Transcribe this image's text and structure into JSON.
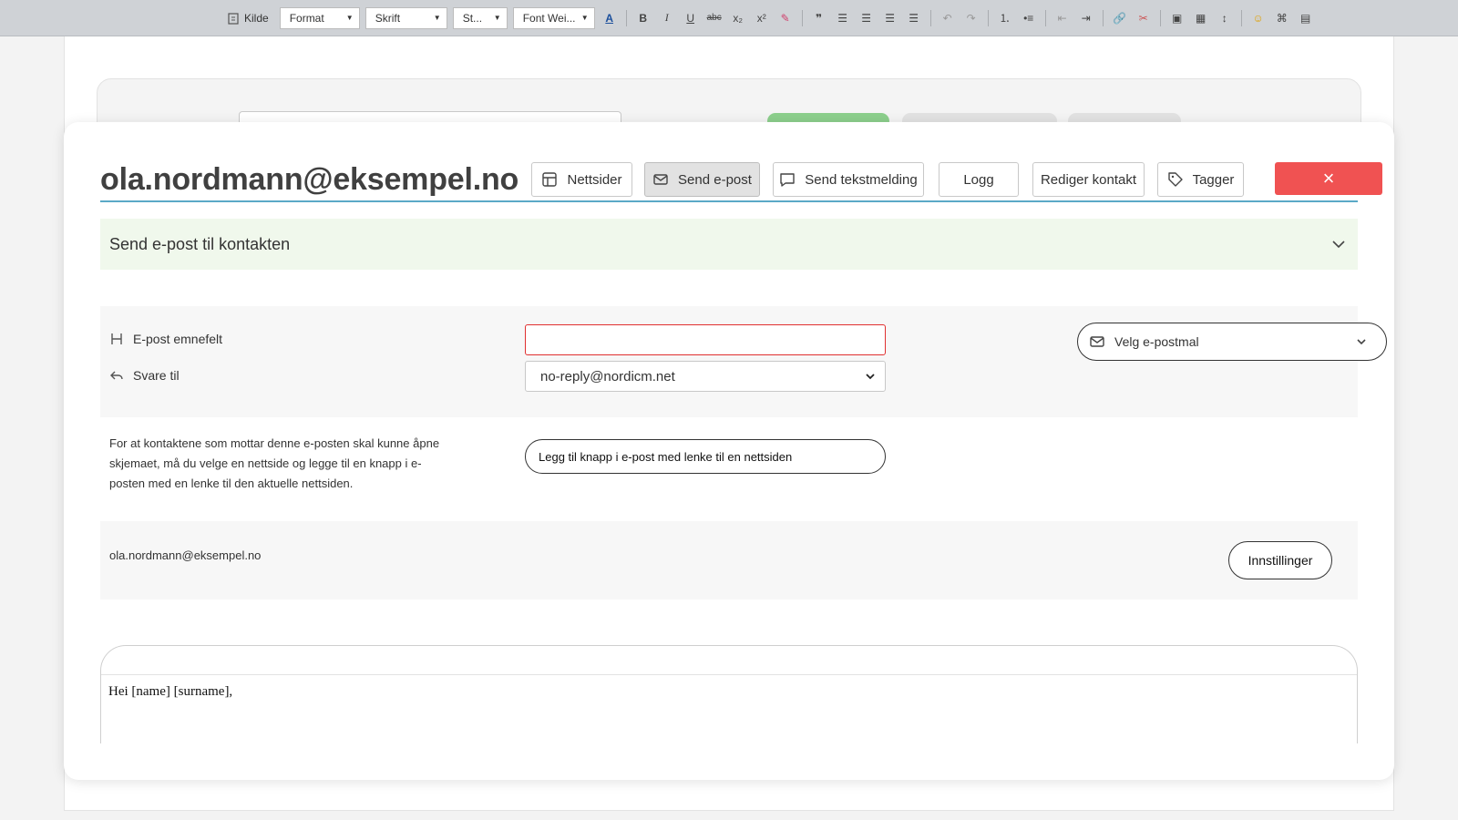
{
  "toolbar": {
    "source_label": "Kilde",
    "format_label": "Format",
    "font_label": "Skrift",
    "style_label": "St...",
    "weight_label": "Font Wei...",
    "icons": [
      "source-icon",
      "text-color-icon",
      "bold-icon",
      "italic-icon",
      "underline-icon",
      "strikethrough-icon",
      "subscript-icon",
      "superscript-icon",
      "remove-format-icon",
      "blockquote-icon",
      "align-left-icon",
      "align-center-icon",
      "align-right-icon",
      "justify-icon",
      "undo-icon",
      "redo-icon",
      "numbered-list-icon",
      "bullet-list-icon",
      "outdent-icon",
      "indent-icon",
      "link-icon",
      "unlink-icon",
      "image-icon",
      "table-icon",
      "line-height-icon",
      "emoji-icon",
      "code-icon",
      "template-icon"
    ]
  },
  "modal": {
    "title": "ola.nordmann@eksempel.no",
    "buttons": {
      "websites": "Nettsider",
      "send_email": "Send e-post",
      "send_sms": "Send tekstmelding",
      "log": "Logg",
      "edit_contact": "Rediger kontakt",
      "tags": "Tagger"
    },
    "close_icon": "×"
  },
  "accordion": {
    "label": "Send e-post til kontakten"
  },
  "form": {
    "subject_label": "E-post emnefelt",
    "subject_value": "",
    "reply_label": "Svare til",
    "reply_value": "no-reply@nordicm.net",
    "template_label": "Velg e-postmal"
  },
  "info": {
    "text": "For at kontaktene som mottar denne e-posten skal kunne åpne skjemaet, må du velge en nettside og legge til en knapp i e-posten med en lenke til den aktuelle nettsiden.",
    "add_button": "Legg til knapp i e-post med lenke til en nettsiden"
  },
  "sender": {
    "email": "ola.nordmann@eksempel.no",
    "settings_button": "Innstillinger"
  },
  "editor": {
    "body": "Hei [name] [surname],"
  },
  "colors": {
    "accent": "#5aa9c7",
    "danger": "#f05252",
    "accordion_bg": "#f0f8ec"
  }
}
